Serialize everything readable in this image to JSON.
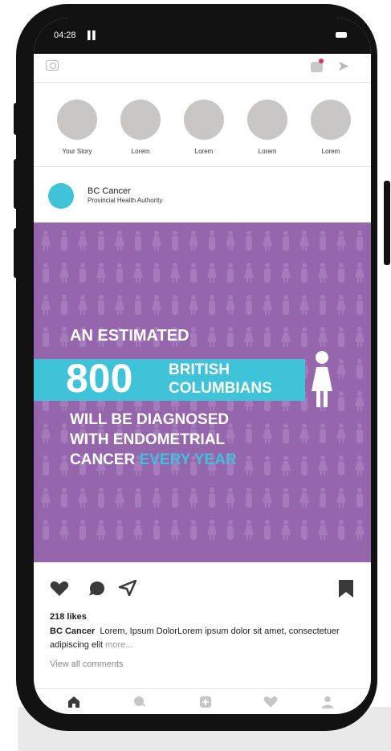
{
  "status_bar": {
    "time": "04:28",
    "signal": "▌▌",
    "battery_icon": "battery-icon"
  },
  "top_bar": {
    "camera_icon": "camera-icon",
    "tv_icon": "igtv-icon",
    "send_icon": "send-icon"
  },
  "stories": [
    {
      "label": "Your Story"
    },
    {
      "label": "Lorem"
    },
    {
      "label": "Lorem"
    },
    {
      "label": "Lorem"
    },
    {
      "label": "Lorem"
    }
  ],
  "post": {
    "account_name": "BC Cancer",
    "account_subtitle": "Provincial Health Authority",
    "avatar_color": "#3ec3d8",
    "image": {
      "background_color": "#9666ad",
      "accent_color": "#3ec3d8",
      "line1": "AN ESTIMATED",
      "number": "800",
      "number_label_1": "BRITISH",
      "number_label_2": "COLUMBIANS",
      "line2": "WILL BE DIAGNOSED",
      "line3": "WITH ENDOMETRIAL",
      "line4_a": "CANCER ",
      "line4_b": "EVERY YEAR"
    },
    "likes": "218 likes",
    "caption_user": "BC Cancer",
    "caption_text": "Lorem, Ipsum DolorLorem ipsum dolor sit amet, consectetuer adipiscing elit",
    "caption_more": "more...",
    "view_comments": "View all comments"
  },
  "bottom_nav": [
    "home-icon",
    "search-icon",
    "add-post-icon",
    "heart-icon",
    "profile-icon"
  ]
}
